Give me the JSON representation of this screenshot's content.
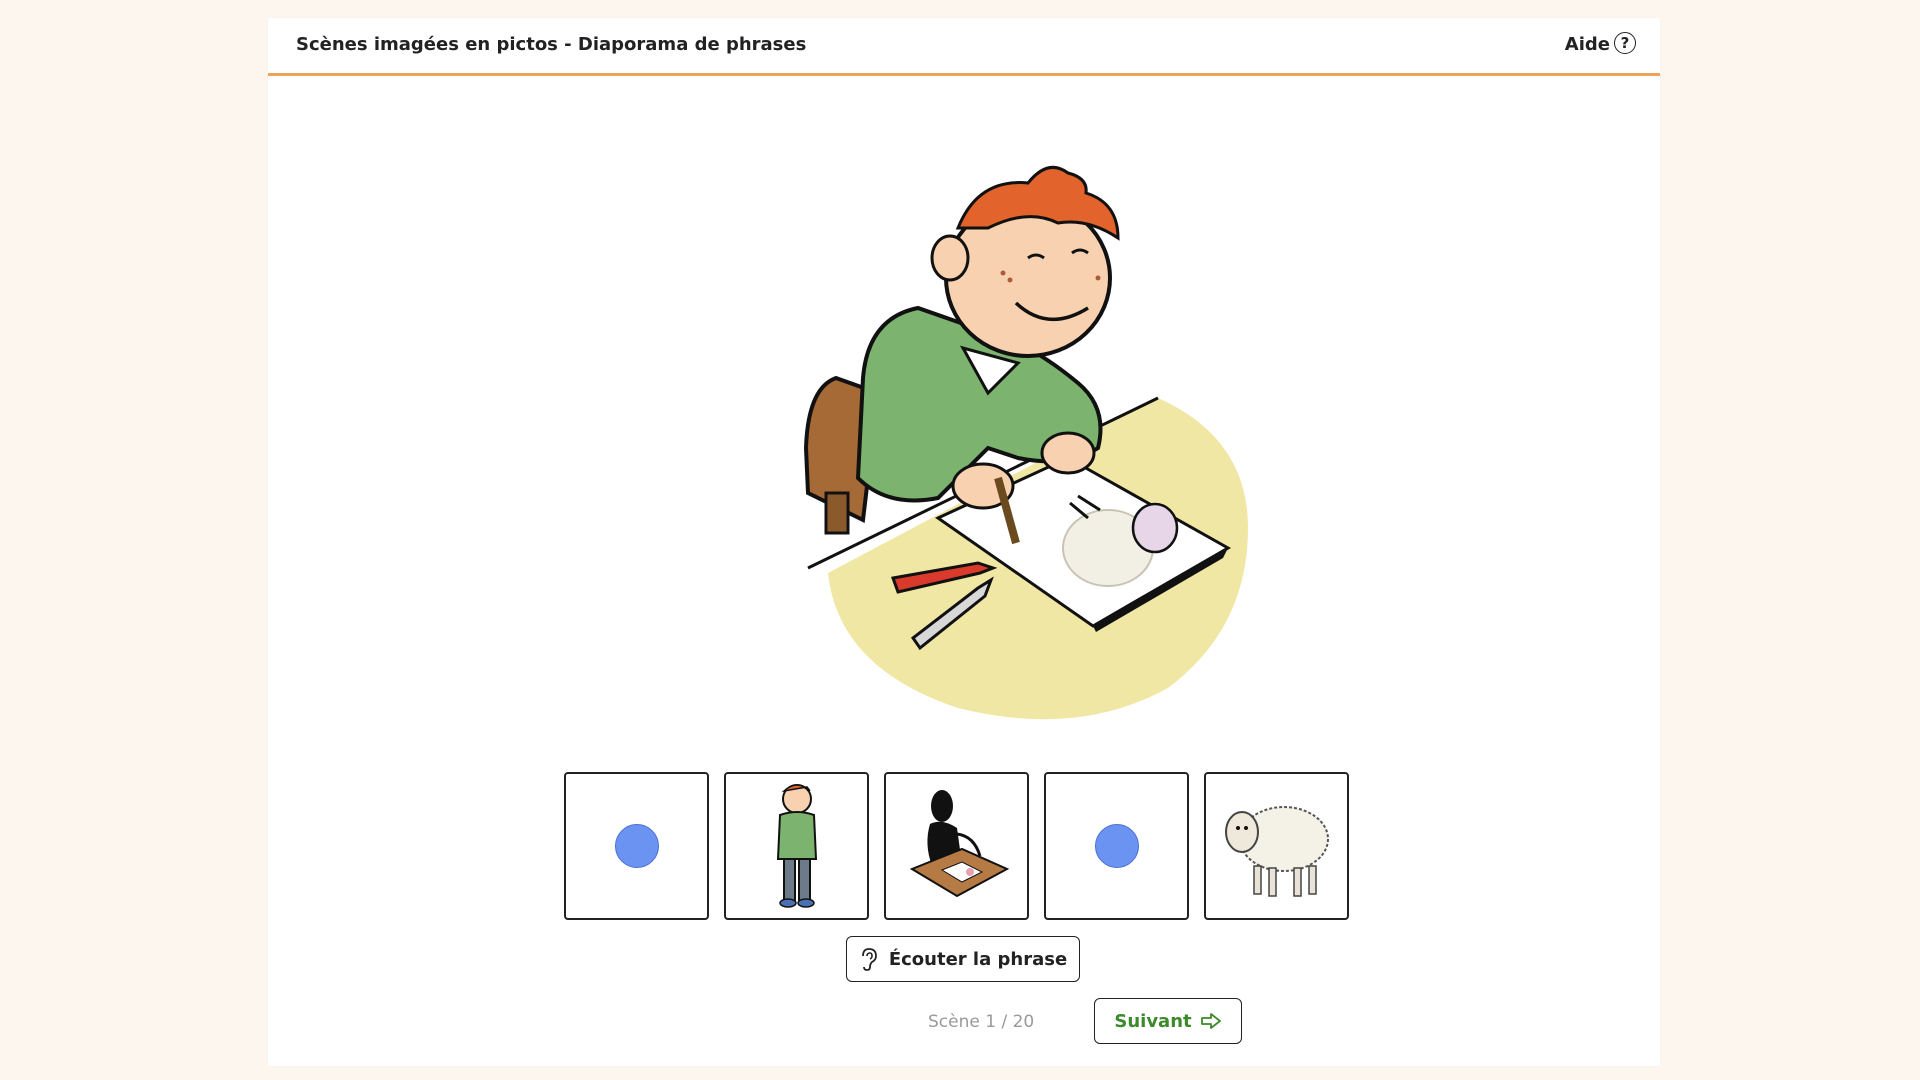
{
  "header": {
    "title": "Scènes imagées en pictos - Diaporama de phrases",
    "help_label": "Aide",
    "help_icon": "question-circle-icon"
  },
  "scene": {
    "image": "boy-drawing-sheep-illustration"
  },
  "pictos": [
    {
      "type": "dot",
      "icon": "blue-dot-icon",
      "color": "#6b94f2"
    },
    {
      "type": "image",
      "icon": "boy-standing-icon"
    },
    {
      "type": "image",
      "icon": "person-drawing-icon"
    },
    {
      "type": "dot",
      "icon": "blue-dot-icon",
      "color": "#6b94f2"
    },
    {
      "type": "image",
      "icon": "sheep-icon"
    }
  ],
  "listen_button": {
    "label": "Écouter la phrase",
    "icon": "ear-icon"
  },
  "counter": "Scène 1 / 20",
  "next_button": {
    "label": "Suivant",
    "icon": "arrow-right-icon"
  },
  "colors": {
    "accent": "#eea35c",
    "next_green": "#3d8a2c",
    "picto_dot": "#6b94f2",
    "background": "#fcf6ee"
  }
}
